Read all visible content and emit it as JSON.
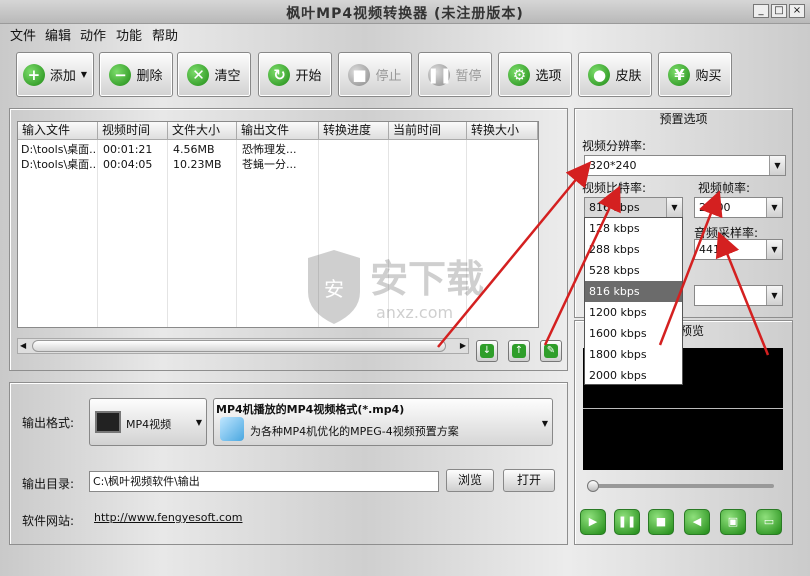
{
  "window": {
    "title": "枫叶MP4视频转换器  (未注册版本)",
    "controls": [
      "_",
      "□",
      "×"
    ]
  },
  "menu": [
    "文件",
    "编辑",
    "动作",
    "功能",
    "帮助"
  ],
  "toolbar": [
    {
      "label": "添加",
      "icon": "add-icon",
      "enabled": true
    },
    {
      "label": "删除",
      "icon": "remove-icon",
      "enabled": true
    },
    {
      "label": "清空",
      "icon": "clear-icon",
      "enabled": true
    },
    {
      "label": "开始",
      "icon": "start-icon",
      "enabled": true
    },
    {
      "label": "停止",
      "icon": "stop-icon",
      "enabled": false
    },
    {
      "label": "暂停",
      "icon": "pause-icon",
      "enabled": false
    },
    {
      "label": "选项",
      "icon": "options-icon",
      "enabled": true
    },
    {
      "label": "皮肤",
      "icon": "skin-icon",
      "enabled": true
    },
    {
      "label": "购买",
      "icon": "buy-icon",
      "enabled": true
    }
  ],
  "file_list": {
    "columns": [
      "输入文件",
      "视频时间",
      "文件大小",
      "输出文件",
      "转换进度",
      "当前时间",
      "转换大小"
    ],
    "rows": [
      [
        "D:\\tools\\桌面...",
        "00:01:21",
        "4.56MB",
        "恐怖理发...",
        "",
        "",
        ""
      ],
      [
        "D:\\tools\\桌面...",
        "00:04:05",
        "10.23MB",
        "苍蝇一分...",
        "",
        "",
        ""
      ]
    ]
  },
  "output": {
    "format_label": "输出格式:",
    "format_button": "MP4视频",
    "format_title": "MP4机播放的MP4视频格式(*.mp4)",
    "format_desc": "为各种MP4机优化的MPEG-4视频预置方案",
    "dir_label": "输出目录:",
    "dir_value": "C:\\枫叶视频软件\\输出",
    "browse": "浏览",
    "open": "打开",
    "site_label": "软件网站:",
    "site_url": "http://www.fengyesoft.com"
  },
  "preset": {
    "title": "预置选项",
    "resolution_label": "视频分辨率:",
    "resolution_value": "320*240",
    "bitrate_label": "视频比特率:",
    "bitrate_value": "816 kbps",
    "framerate_label": "视频帧率:",
    "framerate_value": "25.00",
    "samplerate_label": "音频采样率:",
    "samplerate_value": "44100",
    "bitrate_options": [
      "128 kbps",
      "288 kbps",
      "528 kbps",
      "816 kbps",
      "1200 kbps",
      "1600 kbps",
      "1800 kbps",
      "2000 kbps"
    ],
    "selected_index": 3
  },
  "preview": {
    "title": "预览"
  },
  "watermark": {
    "brand": "安下载",
    "domain": "anxz.com"
  },
  "colors": {
    "accent_green": "#2f9e2a",
    "arrow_red": "#d42020"
  }
}
